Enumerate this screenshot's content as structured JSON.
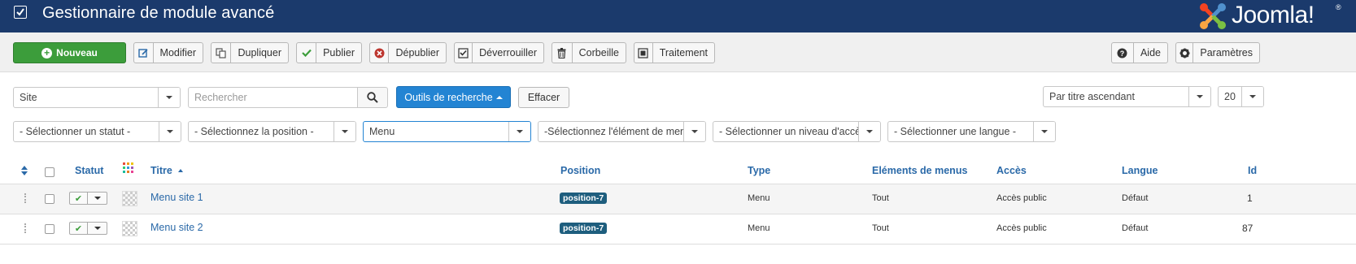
{
  "header": {
    "title": "Gestionnaire de module avancé",
    "logo_text": "Joomla!",
    "logo_reg": "®"
  },
  "toolbar": {
    "new_label": "Nouveau",
    "buttons": [
      {
        "label": "Modifier",
        "icon": "edit-icon"
      },
      {
        "label": "Dupliquer",
        "icon": "copy-icon"
      },
      {
        "label": "Publier",
        "icon": "check-icon"
      },
      {
        "label": "Dépublier",
        "icon": "unpublish-icon"
      },
      {
        "label": "Déverrouiller",
        "icon": "checkin-icon"
      },
      {
        "label": "Corbeille",
        "icon": "trash-icon"
      },
      {
        "label": "Traitement",
        "icon": "batch-icon"
      }
    ],
    "help_label": "Aide",
    "options_label": "Paramètres"
  },
  "filters": {
    "client": "Site",
    "search_placeholder": "Rechercher",
    "search_tools_label": "Outils de recherche",
    "clear_label": "Effacer",
    "ordering": "Par titre ascendant",
    "limit": "20",
    "status": "- Sélectionner un statut -",
    "position": "- Sélectionnez la position -",
    "module": "Menu",
    "menuitem": "-Sélectionnez l'élément de menu-",
    "access": "- Sélectionner un niveau d'accès -",
    "language": "- Sélectionner une langue -"
  },
  "table": {
    "headers": {
      "status": "Statut",
      "title": "Titre",
      "position": "Position",
      "type": "Type",
      "menu_items": "Eléments de menus",
      "access": "Accès",
      "language": "Langue",
      "id": "Id"
    },
    "rows": [
      {
        "title": "Menu site 1",
        "position": "position-7",
        "type": "Menu",
        "menu_items": "Tout",
        "access": "Accès public",
        "language": "Défaut",
        "id": "1"
      },
      {
        "title": "Menu site 2",
        "position": "position-7",
        "type": "Menu",
        "menu_items": "Tout",
        "access": "Accès public",
        "language": "Défaut",
        "id": "87"
      }
    ]
  },
  "colors": {
    "header_bg": "#1b3a6c",
    "new_button": "#3c9d3b",
    "primary": "#2384d3",
    "link": "#2a69a8",
    "badge": "#1e5e7e"
  }
}
